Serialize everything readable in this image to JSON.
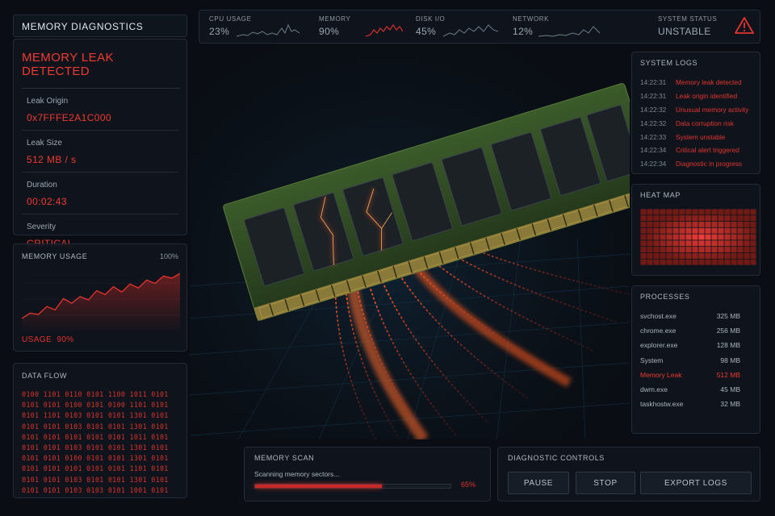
{
  "app": {
    "title": "MEMORY DIAGNOSTICS"
  },
  "leak": {
    "header": "MEMORY LEAK DETECTED",
    "fields": [
      {
        "label": "Leak Origin",
        "value": "0x7FFFE2A1C000"
      },
      {
        "label": "Leak Size",
        "value": "512 MB / s"
      },
      {
        "label": "Duration",
        "value": "00:02:43"
      },
      {
        "label": "Severity",
        "value": "CRITICAL"
      }
    ]
  },
  "memory_usage": {
    "title": "MEMORY USAGE",
    "max_label": "100%",
    "usage_label": "USAGE",
    "usage_value": "90%",
    "series": [
      22,
      30,
      28,
      40,
      35,
      52,
      45,
      55,
      50,
      64,
      58,
      70,
      62,
      74,
      68,
      80,
      75,
      86,
      83,
      90
    ]
  },
  "data_flow": {
    "title": "DATA FLOW",
    "lines": [
      "0100 1101 0110 0101 1100 1011 0101",
      "0101 0101 0100 0101 0100 1101 0101",
      "0101 1101 0103 0101 0101 1301 0101",
      "0101 0101 0103 0101 0101 1301 0101",
      "0101 0101 0101 0101 0101 1011 0101",
      "0101 0101 0103 0101 0101 1301 0101",
      "0101 0101 0100 0101 0101 1301 0101",
      "0101 0101 0101 0101 0101 1101 0101",
      "0101 0101 0103 0101 0101 1301 0101",
      "0101 0101 0103 0103 0101 1001 0101"
    ]
  },
  "topbar": {
    "metrics": [
      {
        "label": "CPU USAGE",
        "value": "23%",
        "alert": false
      },
      {
        "label": "MEMORY",
        "value": "90%",
        "alert": true
      },
      {
        "label": "DISK I/O",
        "value": "45%",
        "alert": false
      },
      {
        "label": "NETWORK",
        "value": "12%",
        "alert": false
      }
    ],
    "status_label": "SYSTEM STATUS",
    "status_value": "UNSTABLE",
    "status_icon": "warning-triangle-icon"
  },
  "logs": {
    "title": "SYSTEM LOGS",
    "items": [
      {
        "time": "14:22:31",
        "msg": "Memory leak detected"
      },
      {
        "time": "14:22:31",
        "msg": "Leak origin identified"
      },
      {
        "time": "14:22:32",
        "msg": "Unusual memory activity"
      },
      {
        "time": "14:22:32",
        "msg": "Data corruption risk"
      },
      {
        "time": "14:22:33",
        "msg": "System unstable"
      },
      {
        "time": "14:22:34",
        "msg": "Critical alert triggered"
      },
      {
        "time": "14:22:34",
        "msg": "Diagnostic in progress"
      }
    ]
  },
  "heatmap": {
    "title": "HEAT MAP"
  },
  "processes": {
    "title": "PROCESSES",
    "items": [
      {
        "name": "svchost.exe",
        "mem": "325 MB",
        "alert": false
      },
      {
        "name": "chrome.exe",
        "mem": "256 MB",
        "alert": false
      },
      {
        "name": "explorer.exe",
        "mem": "128 MB",
        "alert": false
      },
      {
        "name": "System",
        "mem": "98 MB",
        "alert": false
      },
      {
        "name": "Memory Leak",
        "mem": "512 MB",
        "alert": true
      },
      {
        "name": "dwm.exe",
        "mem": "45 MB",
        "alert": false
      },
      {
        "name": "taskhostw.exe",
        "mem": "32 MB",
        "alert": false
      }
    ]
  },
  "scan": {
    "title": "MEMORY SCAN",
    "text": "Scanning memory sectors...",
    "progress": 0.65,
    "progress_label": "65%"
  },
  "controls": {
    "title": "DIAGNOSTIC CONTROLS",
    "pause": "PAUSE",
    "stop": "STOP",
    "export": "EXPORT LOGS"
  },
  "colors": {
    "accent": "#e1332d",
    "background": "#0a0e14",
    "panel": "#10161e"
  }
}
